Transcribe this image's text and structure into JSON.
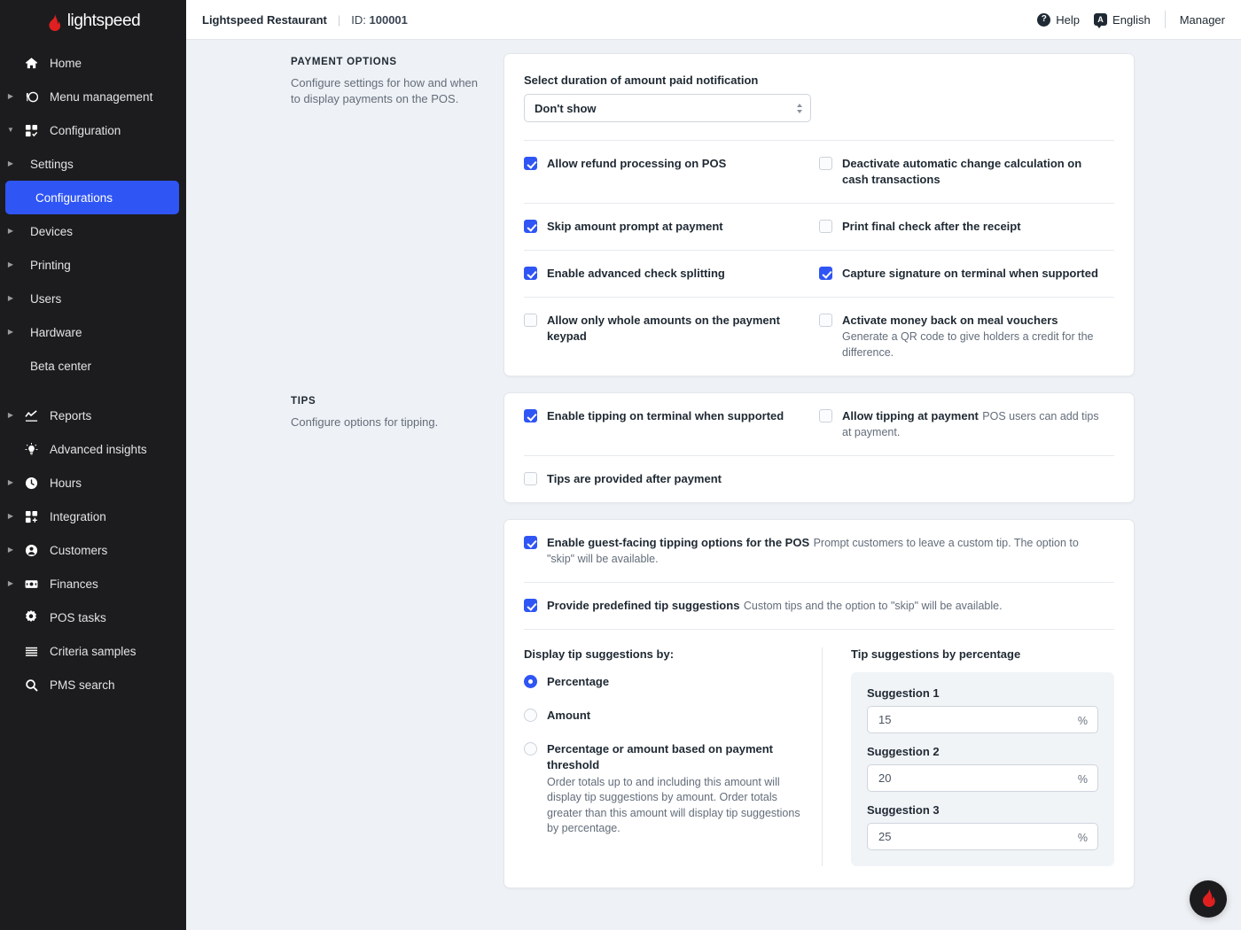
{
  "brand": {
    "name": "lightspeed",
    "logo_icon": "flame-icon"
  },
  "sidebar": {
    "items": [
      {
        "label": "Home",
        "icon": "home-icon",
        "caret": false,
        "sub": false,
        "active": false
      },
      {
        "label": "Menu management",
        "icon": "menu-management-icon",
        "caret": "right",
        "sub": false,
        "active": false
      },
      {
        "label": "Configuration",
        "icon": "configuration-icon",
        "caret": "down",
        "sub": false,
        "active": false
      },
      {
        "label": "Settings",
        "icon": "",
        "caret": "right",
        "sub": true,
        "active": false
      },
      {
        "label": "Configurations",
        "icon": "",
        "caret": false,
        "sub": true,
        "active": true
      },
      {
        "label": "Devices",
        "icon": "",
        "caret": "right",
        "sub": true,
        "active": false
      },
      {
        "label": "Printing",
        "icon": "",
        "caret": "right",
        "sub": true,
        "active": false
      },
      {
        "label": "Users",
        "icon": "",
        "caret": "right",
        "sub": true,
        "active": false
      },
      {
        "label": "Hardware",
        "icon": "",
        "caret": "right",
        "sub": true,
        "active": false
      },
      {
        "label": "Beta center",
        "icon": "",
        "caret": false,
        "sub": true,
        "active": false
      },
      {
        "label": "Reports",
        "icon": "reports-chart-icon",
        "caret": "right",
        "sub": false,
        "active": false
      },
      {
        "label": "Advanced insights",
        "icon": "lightbulb-icon",
        "caret": false,
        "sub": false,
        "active": false
      },
      {
        "label": "Hours",
        "icon": "clock-icon",
        "caret": "right",
        "sub": false,
        "active": false
      },
      {
        "label": "Integration",
        "icon": "integration-icon",
        "caret": "right",
        "sub": false,
        "active": false
      },
      {
        "label": "Customers",
        "icon": "customers-person-icon",
        "caret": "right",
        "sub": false,
        "active": false
      },
      {
        "label": "Finances",
        "icon": "finances-banknote-icon",
        "caret": "right",
        "sub": false,
        "active": false
      },
      {
        "label": "POS tasks",
        "icon": "gear-icon",
        "caret": false,
        "sub": false,
        "active": false
      },
      {
        "label": "Criteria samples",
        "icon": "list-lines-icon",
        "caret": false,
        "sub": false,
        "active": false
      },
      {
        "label": "PMS search",
        "icon": "search-icon",
        "caret": false,
        "sub": false,
        "active": false
      }
    ]
  },
  "topbar": {
    "restaurant": "Lightspeed Restaurant",
    "separator": "|",
    "id_label": "ID:",
    "id_value": "100001",
    "help": "Help",
    "help_icon": "question-mark-circle-icon",
    "language": "English",
    "language_icon": "translate-icon",
    "language_glyph": "A",
    "user": "Manager"
  },
  "payment_options": {
    "section_title": "PAYMENT OPTIONS",
    "section_desc": "Configure settings for how and when to display payments on the POS.",
    "duration_label": "Select duration of amount paid notification",
    "duration_value": "Don't show",
    "checkboxes": [
      {
        "label": "Allow refund processing on POS",
        "help": "",
        "checked": true
      },
      {
        "label": "Deactivate automatic change calculation on cash transactions",
        "help": "",
        "checked": false
      },
      {
        "label": "Skip amount prompt at payment",
        "help": "",
        "checked": true
      },
      {
        "label": "Print final check after the receipt",
        "help": "",
        "checked": false
      },
      {
        "label": "Enable advanced check splitting",
        "help": "",
        "checked": true
      },
      {
        "label": "Capture signature on terminal when supported",
        "help": "",
        "checked": true
      },
      {
        "label": "Allow only whole amounts on the payment keypad",
        "help": "",
        "checked": false
      },
      {
        "label": "Activate money back on meal vouchers",
        "help": "Generate a QR code to give holders a credit for the difference.",
        "checked": false
      }
    ]
  },
  "tips": {
    "section_title": "TIPS",
    "section_desc": "Configure options for tipping.",
    "checkboxes": [
      {
        "label": "Enable tipping on terminal when supported",
        "help": "",
        "checked": true
      },
      {
        "label": "Allow tipping at payment",
        "help": "POS users can add tips at payment.",
        "checked": false
      },
      {
        "label": "Tips are provided after payment",
        "help": "",
        "checked": false
      }
    ]
  },
  "guest_tipping": {
    "checkboxes": [
      {
        "label": "Enable guest-facing tipping options for the POS",
        "help": "Prompt customers to leave a custom tip. The option to \"skip\" will be available.",
        "checked": true
      },
      {
        "label": "Provide predefined tip suggestions",
        "help": "Custom tips and the option to \"skip\" will be available.",
        "checked": true
      }
    ],
    "radio_group_label": "Display tip suggestions by:",
    "radios": [
      {
        "label": "Percentage",
        "help": "",
        "selected": true
      },
      {
        "label": "Amount",
        "help": "",
        "selected": false
      },
      {
        "label": "Percentage or amount based on payment threshold",
        "help": "Order totals up to and including this amount will display tip suggestions by amount. Order totals greater than this amount will display tip suggestions by percentage.",
        "selected": false
      }
    ],
    "suggestions_title": "Tip suggestions by percentage",
    "suggestions": [
      {
        "label": "Suggestion 1",
        "value": "15",
        "unit": "%"
      },
      {
        "label": "Suggestion 2",
        "value": "20",
        "unit": "%"
      },
      {
        "label": "Suggestion 3",
        "value": "25",
        "unit": "%"
      }
    ]
  },
  "fab": {
    "icon": "flame-icon"
  },
  "colors": {
    "accent_blue": "#2f55f5",
    "brand_red": "#e02020",
    "sidebar_bg": "#1c1c1e",
    "page_bg": "#eef1f5",
    "card_bg": "#ffffff"
  }
}
